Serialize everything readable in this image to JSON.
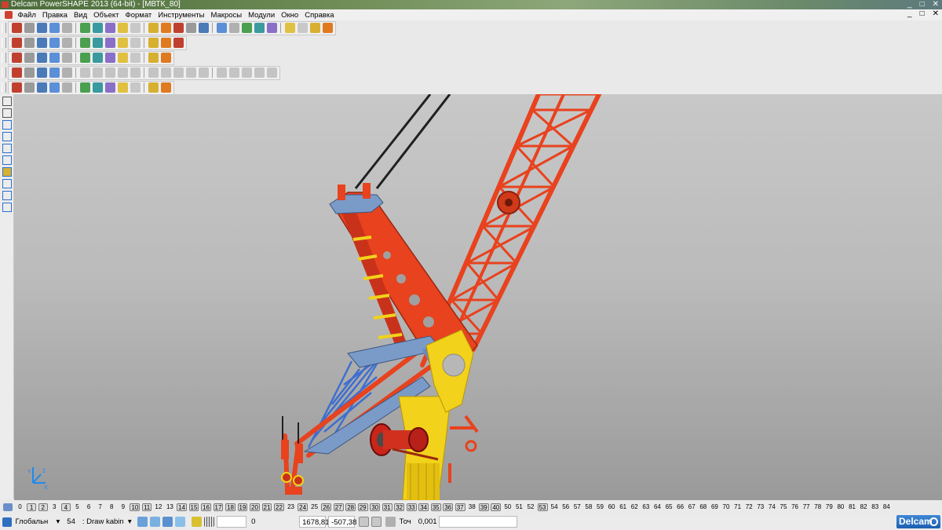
{
  "window": {
    "title": "Delcam PowerSHAPE 2013 (64-bit) - [МВТК_80]",
    "controls": [
      "_",
      "□",
      "✕"
    ]
  },
  "menubar": {
    "items": [
      "Файл",
      "Правка",
      "Вид",
      "Объект",
      "Формат",
      "Инструменты",
      "Макросы",
      "Модули",
      "Окно",
      "Справка"
    ],
    "mdi_controls": [
      "_",
      "□",
      "✕"
    ]
  },
  "toolbars": {
    "row1_icons": [
      "new-icon",
      "open-icon",
      "save-icon",
      "save-as-icon",
      "print-icon",
      "import-icon",
      "cut-icon",
      "copy-icon",
      "paste-icon",
      "delete-icon",
      "undo-icon",
      "redo-icon",
      "repeat-icon",
      "select-icon",
      "select-window-icon",
      "select-lasso-icon",
      "rotate-icon",
      "zoom-icon",
      "pan-icon",
      "shading-icon",
      "cube-icon",
      "layers-icon",
      "wireframe-icon",
      "ruler-icon"
    ],
    "row2_icons": [
      "view-top-icon",
      "view-front-icon",
      "view-right-icon",
      "view-iso-icon",
      "view-iso2-icon",
      "zoom-in-icon",
      "zoom-fit-icon",
      "zoom-box-icon",
      "orbit-icon",
      "shade-icon",
      "render-icon",
      "light-icon",
      "hand-icon"
    ],
    "row3_icons": [
      "doc-icon",
      "solid-icon",
      "sphere-icon",
      "cone-icon",
      "color-icon",
      "play-icon",
      "ramp-icon",
      "box-icon",
      "frame-icon",
      "info-icon",
      "grid-icon",
      "star-icon"
    ],
    "row4_icons": [
      "extrude-icon",
      "revolve-icon",
      "sweep-icon",
      "blend-icon",
      "shell-icon",
      "boolean-icon",
      "fillet-icon",
      "chamfer-icon",
      "draft-icon",
      "cut-solid-icon",
      "split-icon",
      "pattern-icon",
      "mirror-icon",
      "scale-icon",
      "offset-icon",
      "trim-icon",
      "merge-icon",
      "feature-icon",
      "history-icon",
      "tree-icon"
    ],
    "row5_icons": [
      "assembly-icon",
      "axis-icon",
      "part-icon",
      "component-icon",
      "box-icon",
      "mate-icon",
      "explode-icon",
      "section-icon",
      "measure-icon",
      "check-icon",
      "weight-icon",
      "gear-icon"
    ]
  },
  "left_toolbar": {
    "icons": [
      "select-icon",
      "general-edit-icon",
      "line-icon",
      "arc-icon",
      "rectangle-icon",
      "polygon-icon",
      "solid-icon",
      "dimension-icon",
      "curve-icon",
      "sketch-icon"
    ]
  },
  "viewport": {
    "axis_labels": [
      "Y",
      "X",
      "Z"
    ]
  },
  "level_bar": {
    "levels": [
      {
        "n": "0",
        "on": false
      },
      {
        "n": "1",
        "on": true
      },
      {
        "n": "2",
        "on": true
      },
      {
        "n": "3",
        "on": false
      },
      {
        "n": "4",
        "on": true
      },
      {
        "n": "5",
        "on": false
      },
      {
        "n": "6",
        "on": false
      },
      {
        "n": "7",
        "on": false
      },
      {
        "n": "8",
        "on": false
      },
      {
        "n": "9",
        "on": false
      },
      {
        "n": "10",
        "on": true
      },
      {
        "n": "11",
        "on": true
      },
      {
        "n": "12",
        "on": false
      },
      {
        "n": "13",
        "on": false
      },
      {
        "n": "14",
        "on": true
      },
      {
        "n": "15",
        "on": true
      },
      {
        "n": "16",
        "on": true
      },
      {
        "n": "17",
        "on": true
      },
      {
        "n": "18",
        "on": true
      },
      {
        "n": "19",
        "on": true
      },
      {
        "n": "20",
        "on": true
      },
      {
        "n": "21",
        "on": true
      },
      {
        "n": "22",
        "on": true
      },
      {
        "n": "23",
        "on": false
      },
      {
        "n": "24",
        "on": true
      },
      {
        "n": "25",
        "on": false
      },
      {
        "n": "26",
        "on": true
      },
      {
        "n": "27",
        "on": true
      },
      {
        "n": "28",
        "on": true
      },
      {
        "n": "29",
        "on": true
      },
      {
        "n": "30",
        "on": true
      },
      {
        "n": "31",
        "on": true
      },
      {
        "n": "32",
        "on": true
      },
      {
        "n": "33",
        "on": true
      },
      {
        "n": "34",
        "on": true
      },
      {
        "n": "35",
        "on": true
      },
      {
        "n": "36",
        "on": true
      },
      {
        "n": "37",
        "on": true
      },
      {
        "n": "38",
        "on": false
      },
      {
        "n": "39",
        "on": true
      },
      {
        "n": "40",
        "on": true
      },
      {
        "n": "50",
        "on": false
      },
      {
        "n": "51",
        "on": false
      },
      {
        "n": "52",
        "on": false
      },
      {
        "n": "53",
        "on": true
      },
      {
        "n": "54",
        "on": false
      },
      {
        "n": "56",
        "on": false
      },
      {
        "n": "57",
        "on": false
      },
      {
        "n": "58",
        "on": false
      },
      {
        "n": "59",
        "on": false
      },
      {
        "n": "60",
        "on": false
      },
      {
        "n": "61",
        "on": false
      },
      {
        "n": "62",
        "on": false
      },
      {
        "n": "63",
        "on": false
      },
      {
        "n": "64",
        "on": false
      },
      {
        "n": "65",
        "on": false
      },
      {
        "n": "66",
        "on": false
      },
      {
        "n": "67",
        "on": false
      },
      {
        "n": "68",
        "on": false
      },
      {
        "n": "69",
        "on": false
      },
      {
        "n": "70",
        "on": false
      },
      {
        "n": "71",
        "on": false
      },
      {
        "n": "72",
        "on": false
      },
      {
        "n": "73",
        "on": false
      },
      {
        "n": "74",
        "on": false
      },
      {
        "n": "75",
        "on": false
      },
      {
        "n": "76",
        "on": false
      },
      {
        "n": "77",
        "on": false
      },
      {
        "n": "78",
        "on": false
      },
      {
        "n": "79",
        "on": false
      },
      {
        "n": "80",
        "on": false
      },
      {
        "n": "81",
        "on": false
      },
      {
        "n": "82",
        "on": false
      },
      {
        "n": "83",
        "on": false
      },
      {
        "n": "84",
        "on": false
      }
    ]
  },
  "status": {
    "workplane": "Глобальн",
    "level_number": "54",
    "level_name": ": Draw kabin",
    "value_field": "0",
    "x": "1678,81",
    "y": "-507,38",
    "tolerance_label": "Точ",
    "tolerance": "0,001",
    "brand": "Delcam"
  },
  "colors": {
    "boom_red": "#e8421e",
    "tower_yellow": "#f2d21a",
    "plate_blue": "#7a9ac8",
    "brace_blue": "#3e6fd0",
    "cable": "#202020"
  }
}
